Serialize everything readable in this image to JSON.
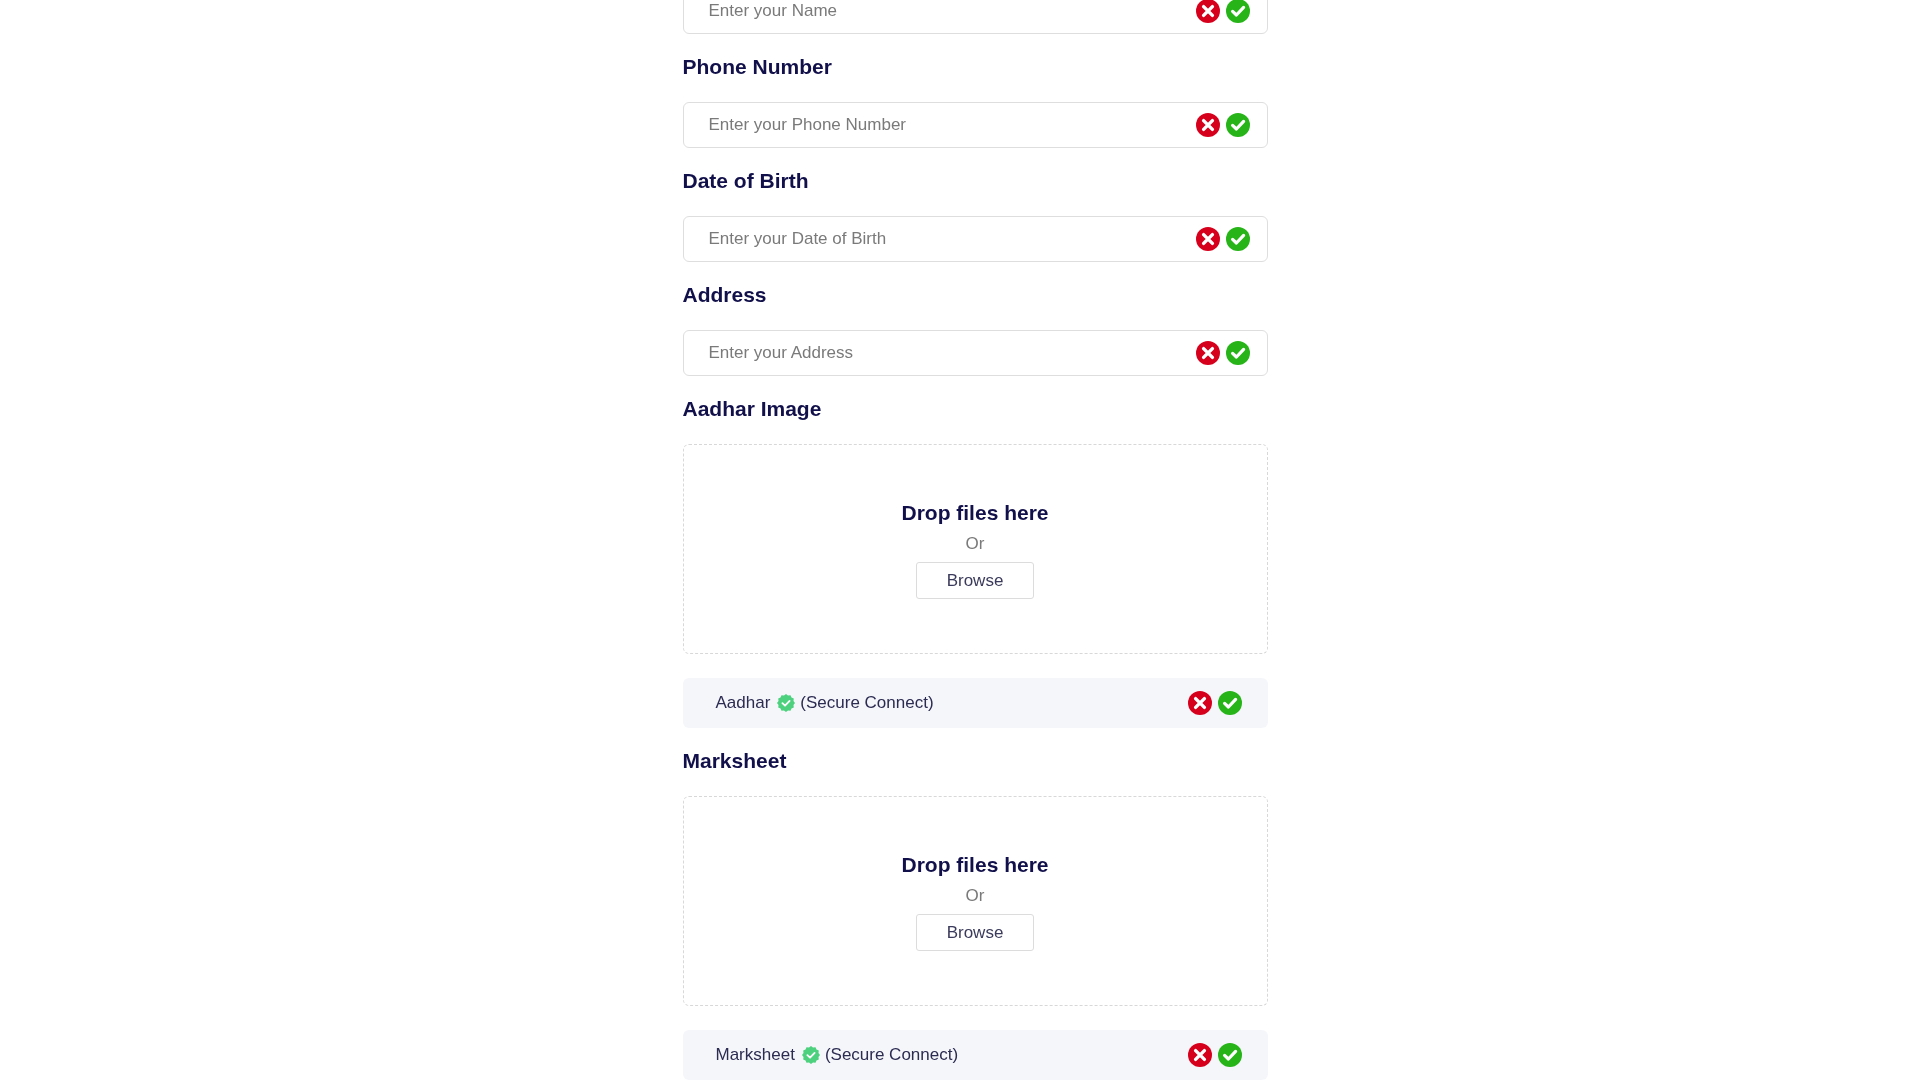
{
  "sections": [
    {
      "kind": "text",
      "placeholder": "Enter your Name"
    },
    {
      "kind": "text",
      "label": "Phone Number",
      "placeholder": "Enter your Phone Number"
    },
    {
      "kind": "text",
      "label": "Date of Birth",
      "placeholder": "Enter your Date of Birth"
    },
    {
      "kind": "text",
      "label": "Address",
      "placeholder": "Enter your Address"
    },
    {
      "kind": "upload",
      "label": "Aadhar Image",
      "drop_text": "Drop files here",
      "or_text": "Or",
      "button": "Browse",
      "document": {
        "name": "Aadhar",
        "note": "(Secure Connect)"
      }
    },
    {
      "kind": "upload",
      "label": "Marksheet",
      "drop_text": "Drop files here",
      "or_text": "Or",
      "button": "Browse",
      "document": {
        "name": "Marksheet",
        "note": "(Secure Connect)"
      }
    }
  ]
}
